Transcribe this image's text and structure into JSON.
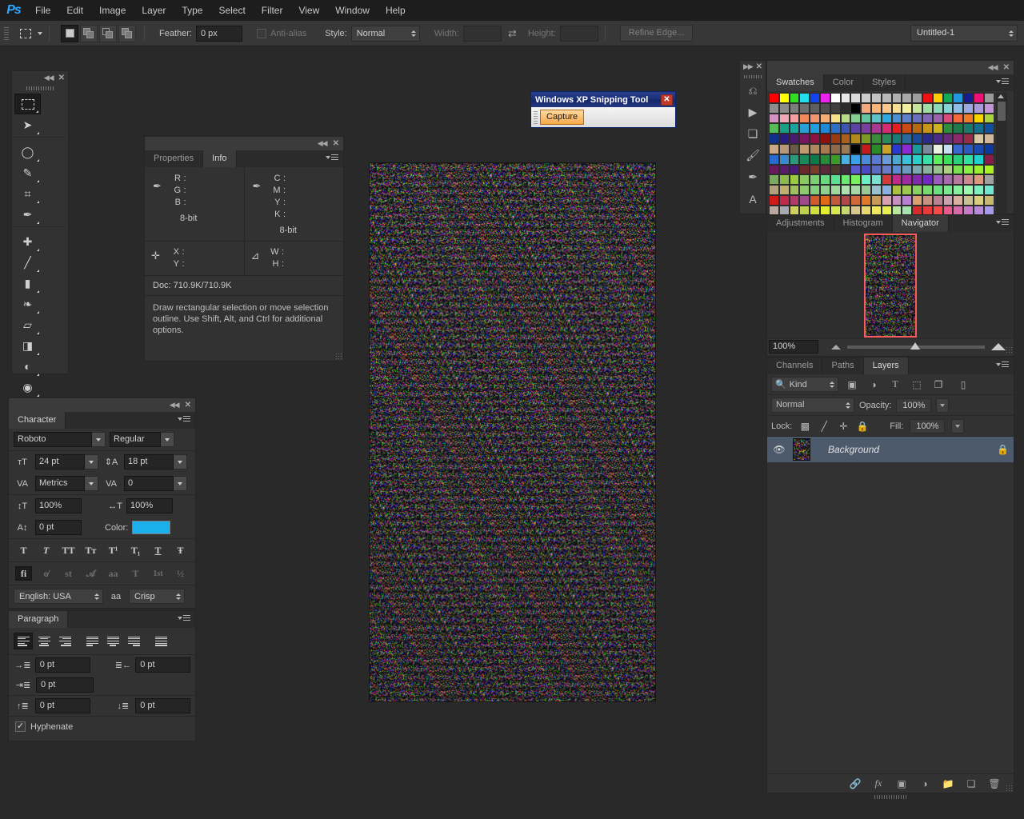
{
  "app": {
    "logo": "Ps",
    "menus": [
      "File",
      "Edit",
      "Image",
      "Layer",
      "Type",
      "Select",
      "Filter",
      "View",
      "Window",
      "Help"
    ]
  },
  "options_bar": {
    "tool_icon": "rectangular-marquee-icon",
    "selection_modes": [
      "new-selection",
      "add-to-selection",
      "subtract-from-selection",
      "intersect-with-selection"
    ],
    "feather_label": "Feather:",
    "feather_value": "0 px",
    "antialias_label": "Anti-alias",
    "antialias_checked": false,
    "style_label": "Style:",
    "style_value": "Normal",
    "width_label": "Width:",
    "width_value": "",
    "height_label": "Height:",
    "height_value": "",
    "refine_edge_label": "Refine Edge...",
    "document_select": "Untitled-1"
  },
  "toolbox": {
    "tools": [
      {
        "name": "rectangular-marquee-tool",
        "glyph": "▭",
        "selected": true
      },
      {
        "name": "move-tool",
        "glyph": "➤",
        "selected": false
      },
      {
        "name": "lasso-tool",
        "glyph": "◯",
        "selected": false
      },
      {
        "name": "quick-selection-tool",
        "glyph": "✎",
        "selected": false
      },
      {
        "name": "crop-tool",
        "glyph": "⌗",
        "selected": false
      },
      {
        "name": "eyedropper-tool",
        "glyph": "✒",
        "selected": false
      },
      {
        "name": "spot-healing-brush-tool",
        "glyph": "✚",
        "selected": false
      },
      {
        "name": "brush-tool",
        "glyph": "🖌",
        "selected": false
      },
      {
        "name": "clone-stamp-tool",
        "glyph": "▮",
        "selected": false
      },
      {
        "name": "history-brush-tool",
        "glyph": "❧",
        "selected": false
      },
      {
        "name": "eraser-tool",
        "glyph": "▱",
        "selected": false
      },
      {
        "name": "gradient-tool",
        "glyph": "◨",
        "selected": false
      },
      {
        "name": "blur-tool",
        "glyph": "💧",
        "selected": false
      },
      {
        "name": "dodge-tool",
        "glyph": "◉",
        "selected": false
      },
      {
        "name": "pen-tool",
        "glyph": "✐",
        "selected": false
      },
      {
        "name": "horizontal-type-tool",
        "glyph": "T",
        "selected": false
      },
      {
        "name": "path-selection-tool",
        "glyph": "➚",
        "selected": false
      },
      {
        "name": "line-tool",
        "glyph": "╱",
        "selected": false
      },
      {
        "name": "hand-tool",
        "glyph": "✋",
        "selected": false
      },
      {
        "name": "zoom-tool",
        "glyph": "🔍",
        "selected": false
      }
    ],
    "foreground_color": "#1bb0ec",
    "background_color": "#ffffff",
    "quick_mask_name": "quick-mask-mode",
    "screen_mode_name": "screen-mode"
  },
  "info_panel": {
    "tabs": [
      {
        "label": "Properties",
        "active": false
      },
      {
        "label": "Info",
        "active": true
      }
    ],
    "rgb": {
      "keys": [
        "R",
        "G",
        "B"
      ],
      "values": [
        "",
        "",
        ""
      ],
      "depth": "8-bit"
    },
    "cmyk": {
      "keys": [
        "C",
        "M",
        "Y",
        "K"
      ],
      "values": [
        "",
        "",
        "",
        ""
      ],
      "depth": "8-bit"
    },
    "position": {
      "keys": [
        "X",
        "Y"
      ],
      "values": [
        "",
        ""
      ]
    },
    "size": {
      "keys": [
        "W",
        "H"
      ],
      "values": [
        "",
        ""
      ]
    },
    "doc_label": "Doc: 710.9K/710.9K",
    "hint": "Draw rectangular selection or move selection outline.  Use Shift, Alt, and Ctrl for additional options."
  },
  "character_panel": {
    "title": "Character",
    "font_family": "Roboto",
    "font_style": "Regular",
    "font_size": "24 pt",
    "leading": "18 pt",
    "kerning": "Metrics",
    "tracking": "0",
    "vertical_scale": "100%",
    "horizontal_scale": "100%",
    "baseline_shift": "0 pt",
    "color_label": "Color:",
    "color_value": "#1bb0ec",
    "style_buttons": [
      {
        "name": "faux-bold",
        "glyph": "T",
        "on": true
      },
      {
        "name": "faux-italic",
        "glyph": "T",
        "on": false
      },
      {
        "name": "all-caps",
        "glyph": "TT",
        "on": false
      },
      {
        "name": "small-caps",
        "glyph": "Tᴛ",
        "on": false
      },
      {
        "name": "superscript",
        "glyph": "T¹",
        "on": false
      },
      {
        "name": "subscript",
        "glyph": "T₁",
        "on": false
      },
      {
        "name": "underline",
        "glyph": "T",
        "on": false
      },
      {
        "name": "strikethrough",
        "glyph": "Ŧ",
        "on": false
      }
    ],
    "opentype_buttons": [
      {
        "name": "standard-ligatures",
        "glyph": "fi",
        "on": true
      },
      {
        "name": "contextual-alternates",
        "glyph": "ᴏ̸",
        "on": false
      },
      {
        "name": "discretionary-ligatures",
        "glyph": "st",
        "on": false
      },
      {
        "name": "swash",
        "glyph": "𝒜",
        "on": false
      },
      {
        "name": "oldstyle",
        "glyph": "aa",
        "on": false
      },
      {
        "name": "titling-alternates",
        "glyph": "T",
        "on": false
      },
      {
        "name": "ordinals",
        "glyph": "1st",
        "on": false
      },
      {
        "name": "fractions",
        "glyph": "½",
        "on": false
      }
    ],
    "language": "English: USA",
    "antialias_method": "Crisp"
  },
  "paragraph_panel": {
    "title": "Paragraph",
    "align_buttons": [
      {
        "name": "align-left",
        "selected": true
      },
      {
        "name": "align-center",
        "selected": false
      },
      {
        "name": "align-right",
        "selected": false
      },
      {
        "name": "justify-last-left",
        "selected": false
      },
      {
        "name": "justify-last-center",
        "selected": false
      },
      {
        "name": "justify-last-right",
        "selected": false
      },
      {
        "name": "justify-all",
        "selected": false
      }
    ],
    "indent_left": "0 pt",
    "indent_right": "0 pt",
    "indent_first_line": "0 pt",
    "space_before": "0 pt",
    "space_after": "0 pt",
    "hyphenate_label": "Hyphenate",
    "hyphenate_checked": true
  },
  "swatches_panel": {
    "tabs": [
      {
        "label": "Swatches",
        "active": true
      },
      {
        "label": "Color",
        "active": false
      },
      {
        "label": "Styles",
        "active": false
      }
    ],
    "new_swatch_name": "new-swatch-button",
    "delete_swatch_name": "delete-swatch-button",
    "colors": [
      "#ff0000",
      "#ffff00",
      "#33dd22",
      "#22ddee",
      "#1144ee",
      "#ee22ee",
      "#ffffff",
      "#e8e8e8",
      "#dddddd",
      "#cccccc",
      "#c2c2c2",
      "#b8b8b8",
      "#b0b0b0",
      "#a8a8a8",
      "#9e9e9e",
      "#ee1111",
      "#ffcc00",
      "#11aa55",
      "#2299dd",
      "#1a1a8f",
      "#ee1177",
      "#9a9a9a",
      "#8d8d8d",
      "#8c8c8c",
      "#7d7d7d",
      "#6e6e6e",
      "#5f5f5f",
      "#4f4f4f",
      "#3f3f3f",
      "#2c2c2c",
      "#000000",
      "#f5a97a",
      "#f7b57e",
      "#f8c98a",
      "#f9dd93",
      "#f3efa0",
      "#c7e39c",
      "#a2dca4",
      "#8fd9bb",
      "#84d3d6",
      "#8fbde6",
      "#9aa9e0",
      "#aa9ada",
      "#c294d6",
      "#d391c0",
      "#efa8b6",
      "#f4a0a0",
      "#f08a5c",
      "#f09470",
      "#f2ae77",
      "#f5e08d",
      "#b9dc8a",
      "#86cf92",
      "#63c4a0",
      "#5fc0c7",
      "#30a8e0",
      "#4f8fd4",
      "#5f7fc8",
      "#6a6fbf",
      "#8266b6",
      "#9c63ad",
      "#d94b7d",
      "#f26a3c",
      "#f07a28",
      "#f5d400",
      "#a9d43c",
      "#57bb5a",
      "#16a085",
      "#1ba39c",
      "#2a9fd6",
      "#1e9fe0",
      "#2088d6",
      "#2b6fc6",
      "#3c55b0",
      "#5a43a3",
      "#7a3f9e",
      "#a8378f",
      "#d62a71",
      "#e02020",
      "#c84b16",
      "#b56a11",
      "#c9941a",
      "#cbb51f",
      "#2d8f3d",
      "#1e7a4a",
      "#177a6a",
      "#146d8c",
      "#0f4f9e",
      "#102f8a",
      "#2a1c7a",
      "#4a1a70",
      "#7a1660",
      "#8c1240",
      "#8c1212",
      "#9a3a12",
      "#a8601a",
      "#b08a1f",
      "#7a9a22",
      "#3c8a3c",
      "#2a8a5a",
      "#1a7a7a",
      "#2a6a9a",
      "#1a4a9a",
      "#2a2a8a",
      "#4a2a8a",
      "#6a2a7a",
      "#8a2a6a",
      "#9a2a4a",
      "#d8c8a8",
      "#d0b898",
      "#c8a888",
      "#b89878",
      "#6a5a4a",
      "#c09a70",
      "#b08860",
      "#a87850",
      "#8c6a4a",
      "#9a7a55",
      "#000000",
      "#c41a1a",
      "#2a8a2a",
      "#caa22a",
      "#2a3ad0",
      "#8a2ad0",
      "#1a9a9a",
      "#7a8a9a",
      "#eaf0e0",
      "#c8dff0",
      "#3a6ad0",
      "#2a5ac0",
      "#1a4ab0",
      "#0a3aa0",
      "#2a6ad0",
      "#3a8ad0",
      "#2a9a7a",
      "#1a8a5a",
      "#0a7a4a",
      "#2a8a3a",
      "#3a9a2a",
      "#4ab0e0",
      "#3aa0e8",
      "#4a8ad8",
      "#5a7ad0",
      "#6a9ad8",
      "#4aa8d0",
      "#3ac0d8",
      "#2ad0c8",
      "#3ae0a8",
      "#5af060",
      "#3ae05a",
      "#2ad07a",
      "#30e0a0",
      "#20d0d0",
      "#8a1a4a",
      "#6a1a5a",
      "#5a1a6a",
      "#4a1a7a",
      "#6a2a2a",
      "#7a3a2a",
      "#5a2a3a",
      "#4a3a2a",
      "#3a2a3a",
      "#5a5ad0",
      "#4a4ac8",
      "#5a6ac0",
      "#6a7ac8",
      "#5a8ad0",
      "#6a9ac0",
      "#7aa8b0",
      "#8ab0a0",
      "#9ac090",
      "#aad080",
      "#7ae050",
      "#8af040",
      "#9af030",
      "#aaf020",
      "#7aaa60",
      "#8aba50",
      "#9aca40",
      "#8ac860",
      "#7ad070",
      "#6ad880",
      "#5ae090",
      "#6ae870",
      "#7af060",
      "#6af0c0",
      "#7ae0d0",
      "#d03a3a",
      "#c02a8a",
      "#a02aa0",
      "#802ab0",
      "#702ac0",
      "#9a5ac0",
      "#aa6ab0",
      "#ba7aa0",
      "#ca8a90",
      "#da9a80",
      "#a0a0a0",
      "#b0a080",
      "#c0b070",
      "#a0c060",
      "#90c870",
      "#80d080",
      "#90d090",
      "#a0d8a0",
      "#b0e0b0",
      "#a8d8a8",
      "#98c898",
      "#9ac0d0",
      "#8ab0e0",
      "#aac040",
      "#9ac850",
      "#8ad060",
      "#7ad870",
      "#6ae080",
      "#7ae890",
      "#8af0a0",
      "#9af8b0",
      "#80f0c0",
      "#70e8d0",
      "#d01a1a",
      "#c02a4a",
      "#b03a6a",
      "#a04a8a",
      "#d05a2a",
      "#e06a1a",
      "#c05a3a",
      "#b04a4a",
      "#d06a3a",
      "#e07a2a",
      "#c89a5a",
      "#d8a0b0",
      "#c890c0",
      "#b880d0",
      "#d8a070",
      "#c89080",
      "#b88090",
      "#c8a0b0",
      "#d8b0a0",
      "#c8c090",
      "#d8d080",
      "#c8b870",
      "#b8a8a0",
      "#a8a8b0",
      "#d0d060",
      "#c0d050",
      "#d0e040",
      "#e0f030",
      "#d8e850",
      "#c8d870",
      "#d8c890",
      "#e8d870",
      "#f0e860",
      "#e8f050",
      "#b8e8a0",
      "#a8e0b0",
      "#d82a2a",
      "#e83a3a",
      "#f84a4a",
      "#e85a8a",
      "#d86aaa",
      "#c87aca",
      "#b88ada",
      "#a89aea",
      "#98aaf0",
      "#88baf0",
      "#f8e840",
      "#e8d850",
      "#d8c860",
      "#c8b870",
      "#d8a860",
      "#e8b850",
      "#f8c840",
      "#e8d830",
      "#d8e820",
      "#c8f010",
      "#b8f020"
    ]
  },
  "navigator_panel": {
    "tabs": [
      {
        "label": "Adjustments",
        "active": false
      },
      {
        "label": "Histogram",
        "active": false
      },
      {
        "label": "Navigator",
        "active": true
      }
    ],
    "zoom_value": "100%",
    "zoom_out_name": "zoom-out-icon",
    "zoom_in_name": "zoom-in-icon"
  },
  "layers_panel": {
    "tabs": [
      {
        "label": "Channels",
        "active": false
      },
      {
        "label": "Paths",
        "active": false
      },
      {
        "label": "Layers",
        "active": true
      }
    ],
    "filter_kind": "Kind",
    "filter_icons": [
      "pixel-layer-filter-icon",
      "adjustment-layer-filter-icon",
      "type-layer-filter-icon",
      "shape-layer-filter-icon",
      "smart-object-filter-icon",
      "filter-toggle-icon"
    ],
    "blend_mode": "Normal",
    "opacity_label": "Opacity:",
    "opacity_value": "100%",
    "lock_label": "Lock:",
    "lock_icons": [
      "lock-transparent-pixels-icon",
      "lock-image-pixels-icon",
      "lock-position-icon",
      "lock-all-icon"
    ],
    "fill_label": "Fill:",
    "fill_value": "100%",
    "layers": [
      {
        "name": "Background",
        "visible": true,
        "locked": true
      }
    ],
    "bottom_icons": [
      "link-layers-icon",
      "layer-style-icon",
      "layer-mask-icon",
      "adjustment-layer-icon",
      "new-group-icon",
      "new-layer-icon",
      "delete-layer-icon"
    ]
  },
  "snipping_tool": {
    "title": "Windows XP Snipping Tool",
    "close_label": "✕",
    "capture_button": "Capture"
  }
}
